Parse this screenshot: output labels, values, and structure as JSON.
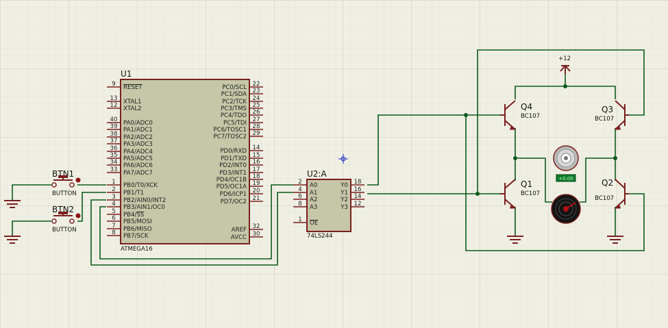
{
  "u1": {
    "ref": "U1",
    "part": "ATMEGA16",
    "left_pins": [
      {
        "num": "9",
        "name": "RESET",
        "overline": true
      },
      {
        "num": "13",
        "name": "XTAL1"
      },
      {
        "num": "12",
        "name": "XTAL2"
      },
      {
        "num": "40",
        "name": "PA0/ADC0"
      },
      {
        "num": "39",
        "name": "PA1/ADC1"
      },
      {
        "num": "38",
        "name": "PA2/ADC2"
      },
      {
        "num": "37",
        "name": "PA3/ADC3"
      },
      {
        "num": "36",
        "name": "PA4/ADC4"
      },
      {
        "num": "35",
        "name": "PA5/ADC5"
      },
      {
        "num": "34",
        "name": "PA6/ADC6"
      },
      {
        "num": "33",
        "name": "PA7/ADC7"
      },
      {
        "num": "1",
        "name": "PB0/T0/XCK"
      },
      {
        "num": "2",
        "name": "PB1/T1"
      },
      {
        "num": "3",
        "name": "PB2/AIN0/INT2"
      },
      {
        "num": "4",
        "name": "PB3/AIN1/OC0"
      },
      {
        "num": "5",
        "name": "PB4/SS"
      },
      {
        "num": "6",
        "name": "PB5/MOSI"
      },
      {
        "num": "7",
        "name": "PB6/MISO"
      },
      {
        "num": "8",
        "name": "PB7/SCK"
      }
    ],
    "right_pins": [
      {
        "num": "22",
        "name": "PC0/SCL"
      },
      {
        "num": "23",
        "name": "PC1/SDA"
      },
      {
        "num": "24",
        "name": "PC2/TCK"
      },
      {
        "num": "25",
        "name": "PC3/TMS"
      },
      {
        "num": "26",
        "name": "PC4/TDO"
      },
      {
        "num": "27",
        "name": "PC5/TDI"
      },
      {
        "num": "28",
        "name": "PC6/TOSC1"
      },
      {
        "num": "29",
        "name": "PC7/TOSC2"
      },
      {
        "num": "14",
        "name": "PD0/RXD"
      },
      {
        "num": "15",
        "name": "PD1/TXD"
      },
      {
        "num": "16",
        "name": "PD2/INT0"
      },
      {
        "num": "17",
        "name": "PD3/INT1"
      },
      {
        "num": "18",
        "name": "PD4/OC1B"
      },
      {
        "num": "19",
        "name": "PD5/OC1A"
      },
      {
        "num": "20",
        "name": "PD6/ICP1"
      },
      {
        "num": "21",
        "name": "PD7/OC2"
      },
      {
        "num": "32",
        "name": "AREF"
      },
      {
        "num": "30",
        "name": "AVCC"
      }
    ]
  },
  "u2": {
    "ref": "U2:A",
    "part": "74LS244",
    "left_pins": [
      {
        "num": "2",
        "name": "A0"
      },
      {
        "num": "4",
        "name": "A1"
      },
      {
        "num": "6",
        "name": "A2"
      },
      {
        "num": "8",
        "name": "A3"
      },
      {
        "num": "1",
        "name": "OE"
      }
    ],
    "right_pins": [
      {
        "num": "18",
        "name": "Y0"
      },
      {
        "num": "16",
        "name": "Y1"
      },
      {
        "num": "14",
        "name": "Y2"
      },
      {
        "num": "12",
        "name": "Y3"
      }
    ]
  },
  "buttons": [
    {
      "ref": "BTN1",
      "part": "BUTTON"
    },
    {
      "ref": "BTN2",
      "part": "BUTTON"
    }
  ],
  "transistors": [
    {
      "ref": "Q4",
      "part": "BC107"
    },
    {
      "ref": "Q3",
      "part": "BC107"
    },
    {
      "ref": "Q1",
      "part": "BC107"
    },
    {
      "ref": "Q2",
      "part": "BC107"
    }
  ],
  "power": {
    "label": "+12"
  },
  "motor": {
    "readout": "+0.00"
  },
  "colors": {
    "background": "#f0efe4",
    "grid_minor": "#dcdcd0",
    "grid_major": "#c8c8bb",
    "component": "#7a1f1f",
    "component_body": "#c6c6a8",
    "wire": "#0b5a1a",
    "cursor": "#2030c0"
  }
}
